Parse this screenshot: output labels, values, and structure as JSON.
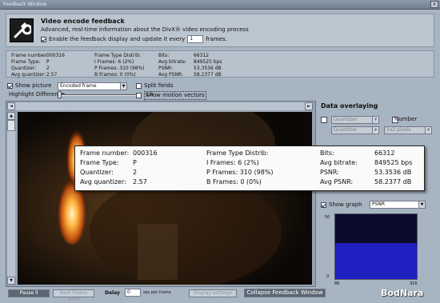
{
  "window": {
    "title": "Feedback Window",
    "close": "x"
  },
  "header": {
    "title": "Video encode feedback",
    "subtitle": "Advanced, real-time information about the DivX® video encoding process",
    "enable_label": "Enable the feedback display and update it every",
    "interval": "1",
    "interval_unit": "frames."
  },
  "stats": {
    "frame_number_label": "Frame number:",
    "frame_number": "000316",
    "frame_type_label": "Frame Type:",
    "frame_type": "P",
    "quantizer_label": "Quantizer:",
    "quantizer": "2",
    "avg_quantizer_label": "Avg quantizer:",
    "avg_quantizer": "2.57",
    "distrib_label": "Frame Type Distrib:",
    "i_frames": "I Frames: 6 (2%)",
    "p_frames": "P Frames: 310 (98%)",
    "b_frames": "B Frames: 0 (0%)",
    "bits_label": "Bits:",
    "bits": "66312",
    "avg_bitrate_label": "Avg bitrate:",
    "avg_bitrate": "849525 bps",
    "psnr_label": "PSNR:",
    "psnr": "53.3536 dB",
    "avg_psnr_label": "Avg PSNR:",
    "avg_psnr": "58.2377 dB"
  },
  "controls": {
    "show_picture": "Show picture",
    "picture_mode": "Encoded frame",
    "split_fields": "Split fields",
    "highlight_label": "Highlight Difference",
    "highlight_value": "1.0",
    "show_motion": "Show motion vectors"
  },
  "data_overlay": {
    "title": "Data overlaying",
    "select1": "Quantizer",
    "number_label": "Number",
    "select2": "Quantizer",
    "select3": "2x2 pixels"
  },
  "graph": {
    "show_label": "Show graph",
    "metric": "PSNR",
    "y_max": "50",
    "y_min": "0",
    "x_min": "88",
    "x_max": "316",
    "level": 0.55
  },
  "bottom": {
    "pause": "Pause ll",
    "next_frame": "Next Frame >>>",
    "delay_label": "Delay",
    "delay_value": "0",
    "delay_unit": "sec per frame",
    "display_settings": "Display settings",
    "collapse": "Collapse Feedback Window"
  },
  "watermark": "BodNara"
}
